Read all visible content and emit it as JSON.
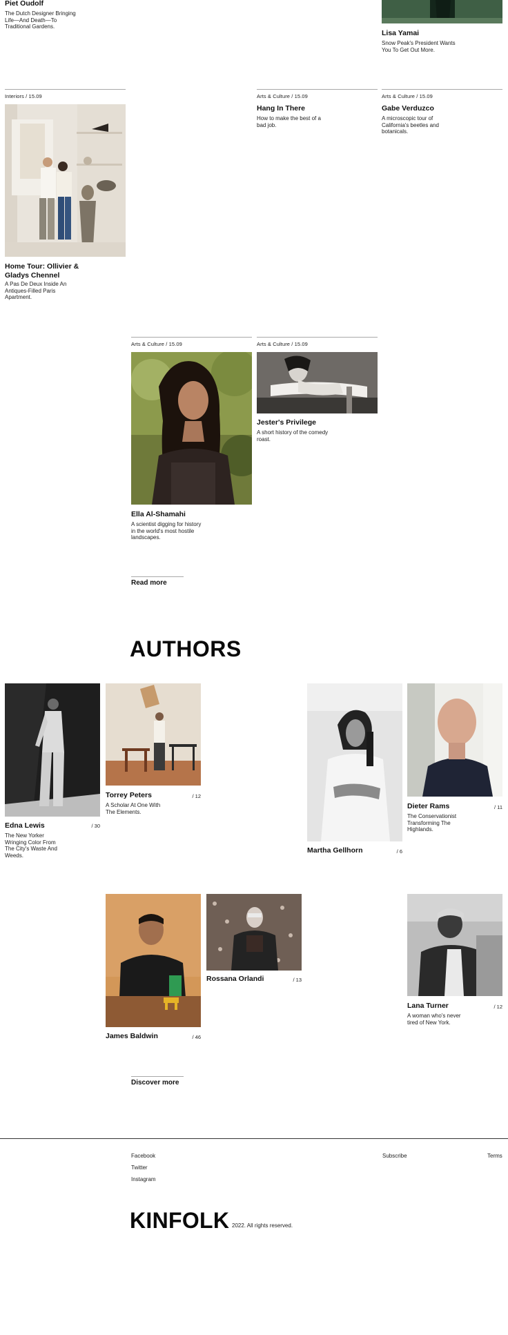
{
  "top": {
    "left_title": "Piet Oudolf",
    "left_desc": "The Dutch Designer Bringing Life—And Death—To Traditional Gardens.",
    "right_title": "Lisa Yamai",
    "right_desc": "Snow Peak's President Wants You To Get Out More."
  },
  "articles": [
    {
      "meta": "Interiors / 15.09",
      "title": "Home Tour: Ollivier & Gladys Chennel",
      "desc": "A Pas De Deux Inside An Antiques-Filled Paris Apartment."
    },
    {
      "meta": "Arts & Culture / 15.09",
      "title": "Hang In There",
      "desc": "How to make the best of a bad job."
    },
    {
      "meta": "Arts & Culture / 15.09",
      "title": "Gabe Verduzco",
      "desc": "A microscopic tour of California's beetles and botanicals."
    },
    {
      "meta": "Arts & Culture / 15.09",
      "title": "Ella Al-Shamahi",
      "desc": "A scientist digging for history in the world's most hostile landscapes."
    },
    {
      "meta": "Arts & Culture / 15.09",
      "title": "Jester's Privilege",
      "desc": "A short history of the comedy roast."
    }
  ],
  "read_more": "Read more",
  "authors_heading": "AUTHORS",
  "authors": [
    {
      "name": "Edna Lewis",
      "count": "/ 30",
      "desc": "The New Yorker Wringing Color From The City's Waste And Weeds."
    },
    {
      "name": "Torrey Peters",
      "count": "/ 12",
      "desc": "A Scholar At One With The Elements."
    },
    {
      "name": "Martha Gellhorn",
      "count": "/ 6",
      "desc": ""
    },
    {
      "name": "Dieter Rams",
      "count": "/ 11",
      "desc": "The Conservationist Transforming The Highlands."
    },
    {
      "name": "James Baldwin",
      "count": "/ 46",
      "desc": ""
    },
    {
      "name": "Rossana Orlandi",
      "count": "/ 13",
      "desc": ""
    },
    {
      "name": "Lana Turner",
      "count": "/ 12",
      "desc": "A woman who's never tired of New York."
    }
  ],
  "discover_more": "Discover more",
  "footer": {
    "facebook": "Facebook",
    "twitter": "Twitter",
    "instagram": "Instagram",
    "subscribe": "Subscribe",
    "terms": "Terms",
    "logo": "KINFOLK",
    "copyright": "2022. All rights reserved."
  },
  "colors": {
    "background": "#ffffff",
    "text": "#111111",
    "rule": "#a8a8a8"
  }
}
